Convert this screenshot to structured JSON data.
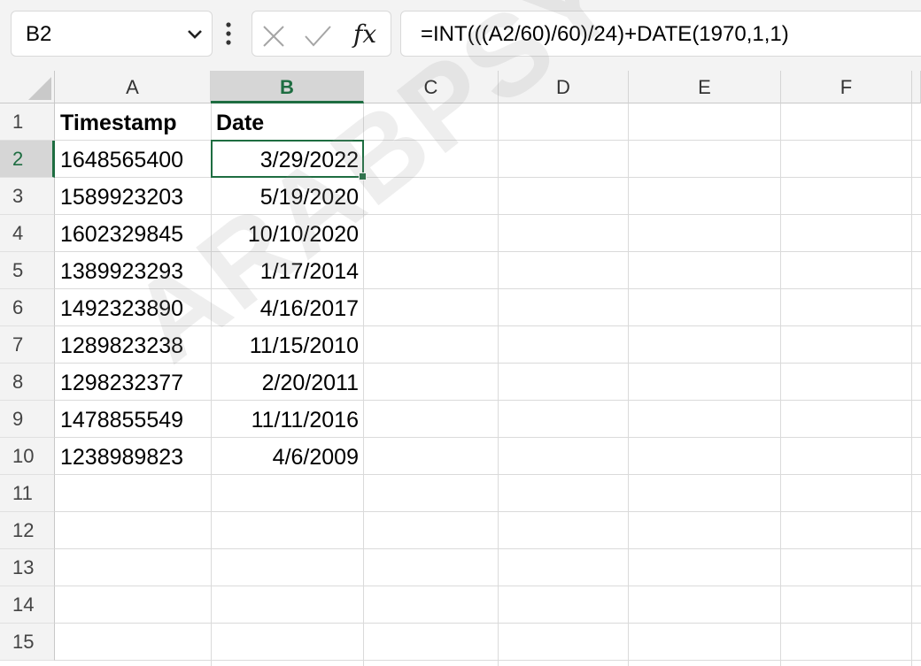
{
  "namebox": {
    "value": "B2"
  },
  "formula_bar": {
    "formula": "=INT(((A2/60)/60)/24)+DATE(1970,1,1)",
    "fx_label": "fx"
  },
  "columns": [
    "A",
    "B",
    "C",
    "D",
    "E",
    "F"
  ],
  "rows": [
    "1",
    "2",
    "3",
    "4",
    "5",
    "6",
    "7",
    "8",
    "9",
    "10",
    "11",
    "12",
    "13",
    "14",
    "15"
  ],
  "selected": {
    "cell": "B2",
    "column": "B",
    "row": "2"
  },
  "sheet": {
    "headers": {
      "a": "Timestamp",
      "b": "Date"
    },
    "data": [
      {
        "timestamp": "1648565400",
        "date": "3/29/2022"
      },
      {
        "timestamp": "1589923203",
        "date": "5/19/2020"
      },
      {
        "timestamp": "1602329845",
        "date": "10/10/2020"
      },
      {
        "timestamp": "1389923293",
        "date": "1/17/2014"
      },
      {
        "timestamp": "1492323890",
        "date": "4/16/2017"
      },
      {
        "timestamp": "1289823238",
        "date": "11/15/2010"
      },
      {
        "timestamp": "1298232377",
        "date": "2/20/2011"
      },
      {
        "timestamp": "1478855549",
        "date": "11/11/2016"
      },
      {
        "timestamp": "1238989823",
        "date": "4/6/2009"
      }
    ]
  },
  "watermark": "ARABPSYCHO",
  "colors": {
    "accent": "#1e6d41",
    "header_bg": "#f3f3f3",
    "gridline": "#dadada"
  }
}
